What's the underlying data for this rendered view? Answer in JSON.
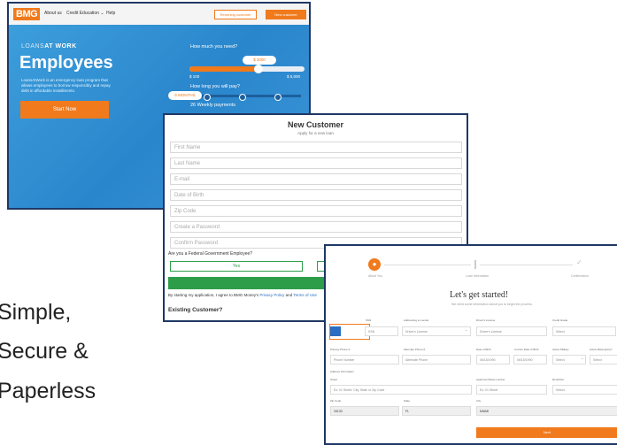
{
  "tagline": [
    "Simple,",
    "Secure &",
    "Paperless"
  ],
  "landing": {
    "logo": "BMG",
    "nav": [
      "About us",
      "Credit Education ⌄",
      "Help"
    ],
    "returning_label": "Returning customer",
    "new_label": "New customer",
    "brand_prefix": "LOANS",
    "brand_suffix": "AT WORK",
    "hero": "Employees",
    "description": "LoansAtWork is an emergency loan program that allows employees to borrow responsibly and repay debt in affordable installments.",
    "start_label": "Start Now",
    "amount_question": "How much you need?",
    "amount_value": "$ 3000",
    "amount_fraction": 0.6,
    "min_label": "$ 100",
    "max_label": "$ 5,000",
    "term_question": "How long you will pay?",
    "term_value": "6 MONTHS",
    "payments_label": "26 Weekly payments"
  },
  "new_customer": {
    "title": "New Customer",
    "subtitle": "Apply for a new loan",
    "fields": [
      "First Name",
      "Last Name",
      "E-mail",
      "Date of Birth",
      "Zip Code",
      "Create a Password",
      "Confirm Password"
    ],
    "federal_question": "Are you a Federal Government Employee?",
    "yes_label": "Yes",
    "apply_label": "Start My Appli",
    "terms_text": "By starting my application, I agree to BMG Money's ",
    "privacy_link": "Privacy Policy",
    "and_text": " and ",
    "terms_link": "Terms of Use",
    "existing_label": "Existing Customer?"
  },
  "get_started": {
    "steps": [
      "About You",
      "Loan Information",
      "Confirmation"
    ],
    "heading": "Let's get started!",
    "subheading": "We need some information about you to begin the process.",
    "rows": [
      {
        "labels": [
          "Position Title",
          "SSN",
          "Addressing to Lender",
          "Driver's License",
          "Credit Grade"
        ],
        "values": [
          "",
          "SSN",
          "Driver's License",
          "Driver's License",
          "Select"
        ]
      },
      {
        "labels": [
          "Primary Phone #",
          "Alternate Phone #",
          "Date of Birth",
          "Current Date of Birth",
          "Active Military",
          "Active Bankruptcy?"
        ],
        "values": [
          "Phone Number",
          "Alternate Phone",
          "06/15/1990",
          "06/15/1990",
          "Select",
          "Select"
        ]
      },
      {
        "labels": [
          "Address Information",
          "Street",
          "Apartment/Suite number",
          "Rent/Own"
        ],
        "values": [
          "Ex: 01 Street, City, State or Zip Code",
          "Ex: 01 Street",
          "Select"
        ]
      },
      {
        "labels": [
          "Zip Code",
          "State",
          "City"
        ],
        "values": [
          "33133",
          "FL",
          "MIAMI"
        ]
      }
    ],
    "submit_label": "Next"
  },
  "colors": {
    "orange": "#f07a1c",
    "blue": "#2a86cc",
    "green": "#2e9d4a",
    "frame": "#1f3864"
  }
}
